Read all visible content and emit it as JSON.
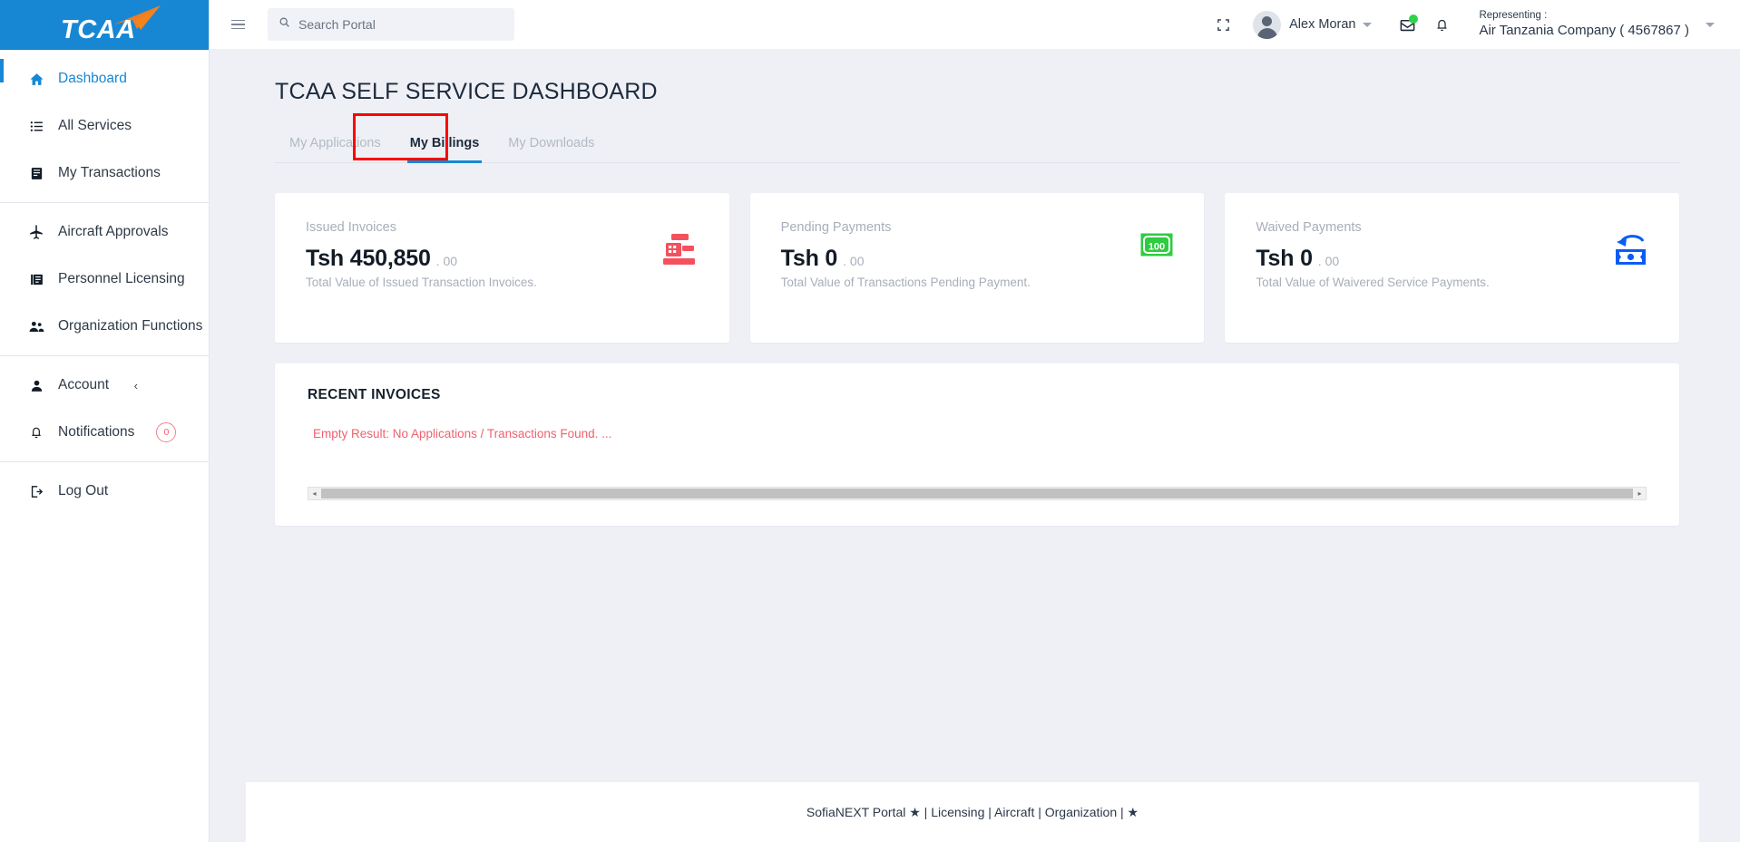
{
  "brand": {
    "logo_text": "TCAA",
    "logo_icon": "paper-plane-icon",
    "band_color": "#1787d4",
    "plane_color": "#f47b20"
  },
  "sidebar": {
    "groups": [
      {
        "items": [
          {
            "label": "Dashboard",
            "icon": "home-icon",
            "active": true
          },
          {
            "label": "All Services",
            "icon": "list-icon",
            "active": false
          },
          {
            "label": "My Transactions",
            "icon": "book-icon",
            "active": false
          }
        ]
      },
      {
        "items": [
          {
            "label": "Aircraft Approvals",
            "icon": "airplane-icon",
            "active": false
          },
          {
            "label": "Personnel Licensing",
            "icon": "id-card-icon",
            "active": false
          },
          {
            "label": "Organization Functions",
            "icon": "people-icon",
            "active": false
          }
        ]
      },
      {
        "items": [
          {
            "label": "Account",
            "icon": "person-icon",
            "active": false,
            "chevron": "‹"
          },
          {
            "label": "Notifications",
            "icon": "bell-icon",
            "active": false,
            "badge": "0"
          }
        ]
      },
      {
        "items": [
          {
            "label": "Log Out",
            "icon": "logout-icon",
            "active": false
          }
        ]
      }
    ]
  },
  "topbar": {
    "menu_toggle_icon": "hamburger-icon",
    "search": {
      "icon": "search-icon",
      "value": "",
      "placeholder": "Search Portal"
    },
    "fullscreen_icon": "fullscreen-icon",
    "avatar_icon": "avatar",
    "user_name": "Alex Moran",
    "user_caret_icon": "chevron-down-icon",
    "mail_icon": "mail-icon",
    "mail_badge_color": "#2fd34a",
    "bell_icon": "bell-icon",
    "representing_label": "Representing :",
    "representing_value": "Air Tanzania Company ( 4567867 )",
    "representing_caret_icon": "chevron-down-icon"
  },
  "page": {
    "title": "TCAA SELF SERVICE DASHBOARD",
    "tabs": [
      {
        "label": "My Applications",
        "active": false
      },
      {
        "label": "My Billings",
        "active": true
      },
      {
        "label": "My Downloads",
        "active": false
      }
    ],
    "highlight_color": "#fe0000",
    "active_tab_underline_color": "#1787d4"
  },
  "cards": [
    {
      "label": "Issued Invoices",
      "amount": "Tsh 450,850",
      "cents": ". 00",
      "subtitle": "Total Value of Issued Transaction Invoices.",
      "icon": "cash-register-icon",
      "icon_color": "#f4515f"
    },
    {
      "label": "Pending Payments",
      "amount": "Tsh 0",
      "cents": ". 00",
      "subtitle": "Total Value of Transactions Pending Payment.",
      "icon": "banknote-100-icon",
      "icon_color": "#2ecc40",
      "icon_text": "100"
    },
    {
      "label": "Waived Payments",
      "amount": "Tsh 0",
      "cents": ". 00",
      "subtitle": "Total Value of Waivered Service Payments.",
      "icon": "money-refund-icon",
      "icon_color": "#0a5cf5"
    }
  ],
  "recent_invoices": {
    "title": "RECENT INVOICES",
    "empty_message": "Empty Result: No Applications / Transactions Found. ...",
    "empty_color": "#f0616f",
    "scrollbar": {
      "left_arrow": "◂",
      "right_arrow": "▸"
    }
  },
  "footer": {
    "text": "SofiaNEXT Portal ★ | Licensing | Aircraft | Organization | ★"
  }
}
